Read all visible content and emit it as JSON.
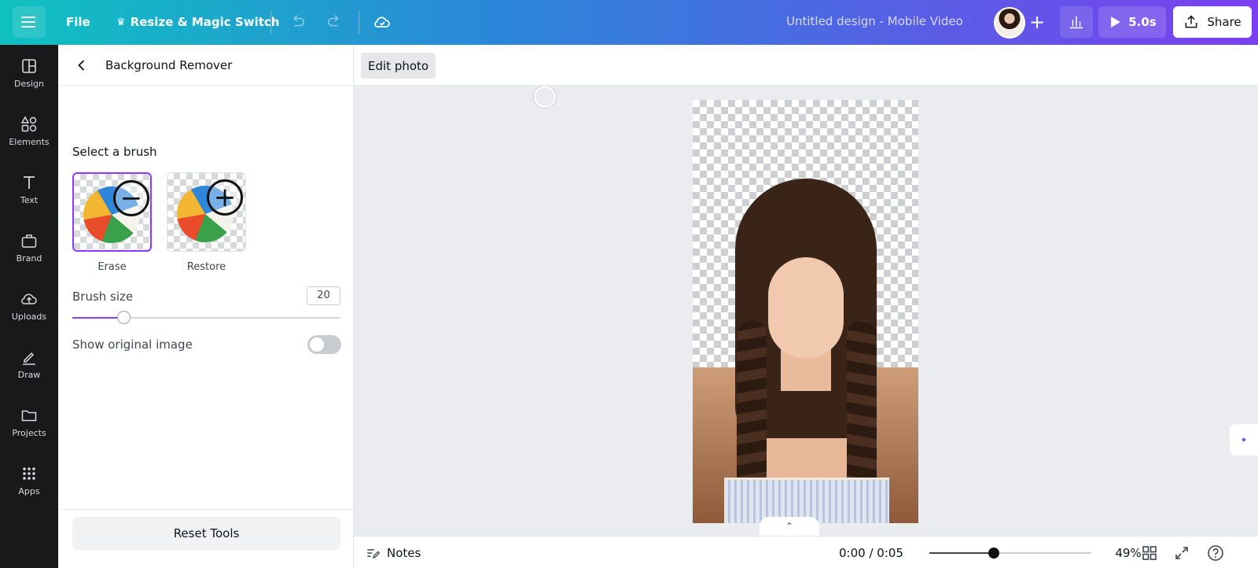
{
  "topbar": {
    "file_label": "File",
    "resize_label": "Resize & Magic Switch",
    "doc_title": "Untitled design - Mobile Video",
    "play_label": "5.0s",
    "share_label": "Share",
    "icons": [
      "menu-icon",
      "crown-icon",
      "undo-icon",
      "redo-icon",
      "cloud-icon",
      "plus-icon",
      "bar-chart-icon",
      "play-icon",
      "upload-icon"
    ]
  },
  "rail": {
    "items": [
      {
        "label": "Design",
        "icon": "layout-icon"
      },
      {
        "label": "Elements",
        "icon": "shapes-icon"
      },
      {
        "label": "Text",
        "icon": "text-icon"
      },
      {
        "label": "Brand",
        "icon": "briefcase-icon"
      },
      {
        "label": "Uploads",
        "icon": "cloud-upload-icon"
      },
      {
        "label": "Draw",
        "icon": "pen-icon"
      },
      {
        "label": "Projects",
        "icon": "folder-icon"
      },
      {
        "label": "Apps",
        "icon": "grid-icon"
      }
    ]
  },
  "panel": {
    "title": "Background Remover",
    "section_label": "Select a brush",
    "brushes": [
      {
        "label": "Erase",
        "selected": true
      },
      {
        "label": "Restore",
        "selected": false
      }
    ],
    "brush_size_label": "Brush size",
    "brush_size_value": "20",
    "brush_size_fraction": 0.19,
    "show_original_label": "Show original image",
    "show_original_on": false,
    "reset_label": "Reset Tools"
  },
  "canvas": {
    "edit_photo_label": "Edit photo",
    "handle_icon": "chevron-up-icon"
  },
  "bottombar": {
    "notes_label": "Notes",
    "timecode": "0:00 / 0:05",
    "zoom_label": "49%",
    "zoom_fraction": 0.4
  },
  "colors": {
    "accent": "#8b3dff",
    "rail_bg": "#18191b",
    "canvas_bg": "#ebecf0"
  }
}
